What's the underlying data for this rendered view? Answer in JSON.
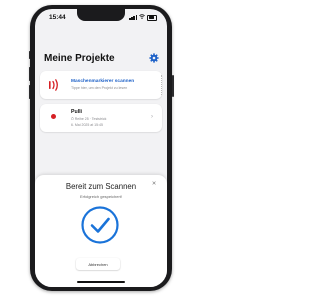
{
  "status_bar": {
    "time": "15:44"
  },
  "header": {
    "title": "Meine Projekte",
    "settings_icon": "gear-icon"
  },
  "scan_card": {
    "title": "Maschenmarkierer scannen",
    "subtitle": "Tippe hier, um den Projekt zu lesen",
    "icon": "nfc-scan-icon"
  },
  "projects": [
    {
      "name": "Pulli",
      "location": "Ō Reihe 25 · Teststrick",
      "date": "6. Mai 2025 at 15:45",
      "status_color": "#d62024"
    }
  ],
  "scan_sheet": {
    "title": "Bereit zum Scannen",
    "subtitle": "Erfolgreich gespeichert!",
    "cancel_label": "Abbrechen",
    "icon": "checkmark-circle-icon",
    "accent": "#1a73d9"
  },
  "colors": {
    "accent": "#1f62c8",
    "nfc_icon": "#d62024",
    "background": "#f2f2f4"
  }
}
